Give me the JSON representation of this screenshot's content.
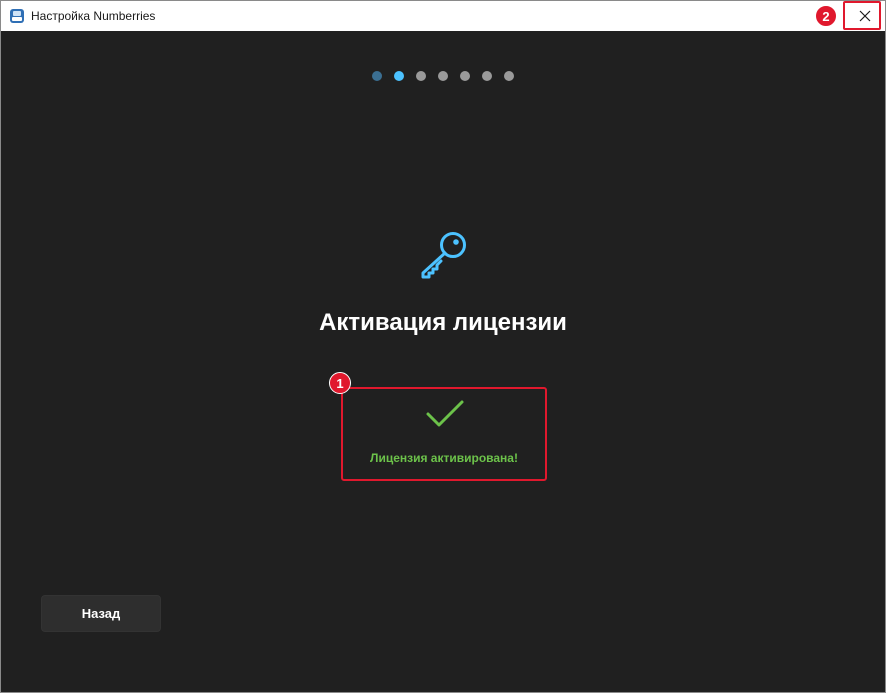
{
  "window": {
    "title": "Настройка Numberries",
    "close_icon": "close-icon",
    "app_icon": "installer-app-icon"
  },
  "steps": {
    "total": 7,
    "current": 2,
    "colors": {
      "done": "#3b6f92",
      "active": "#4cc2ff",
      "pending": "#9a9a9a"
    }
  },
  "main": {
    "icon": "key-icon",
    "title": "Активация лицензии",
    "status": {
      "icon": "checkmark-icon",
      "text": "Лицензия активирована!",
      "color": "#6cc24a"
    }
  },
  "footer": {
    "back_label": "Назад"
  },
  "annotations": {
    "badge_1": "1",
    "badge_2": "2",
    "color": "#e0182d"
  }
}
